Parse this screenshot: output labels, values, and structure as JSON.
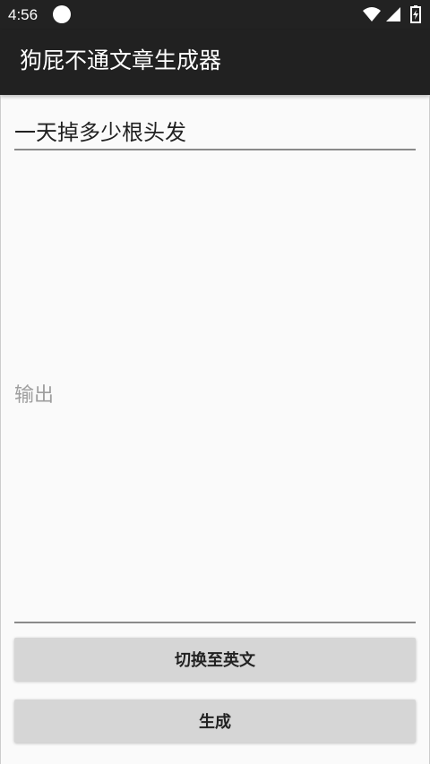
{
  "status_bar": {
    "time": "4:56",
    "icons": [
      "notification-dot-icon",
      "wifi-icon",
      "signal-icon",
      "battery-icon"
    ]
  },
  "app_bar": {
    "title": "狗屁不通文章生成器"
  },
  "input": {
    "value": "一天掉多少根头发"
  },
  "output": {
    "placeholder": "输出"
  },
  "buttons": {
    "switch_label": "切换至英文",
    "generate_label": "生成"
  },
  "colors": {
    "app_bar": "#212121",
    "status_bar": "#222222",
    "background": "#fafafa",
    "button": "#d6d6d6"
  }
}
